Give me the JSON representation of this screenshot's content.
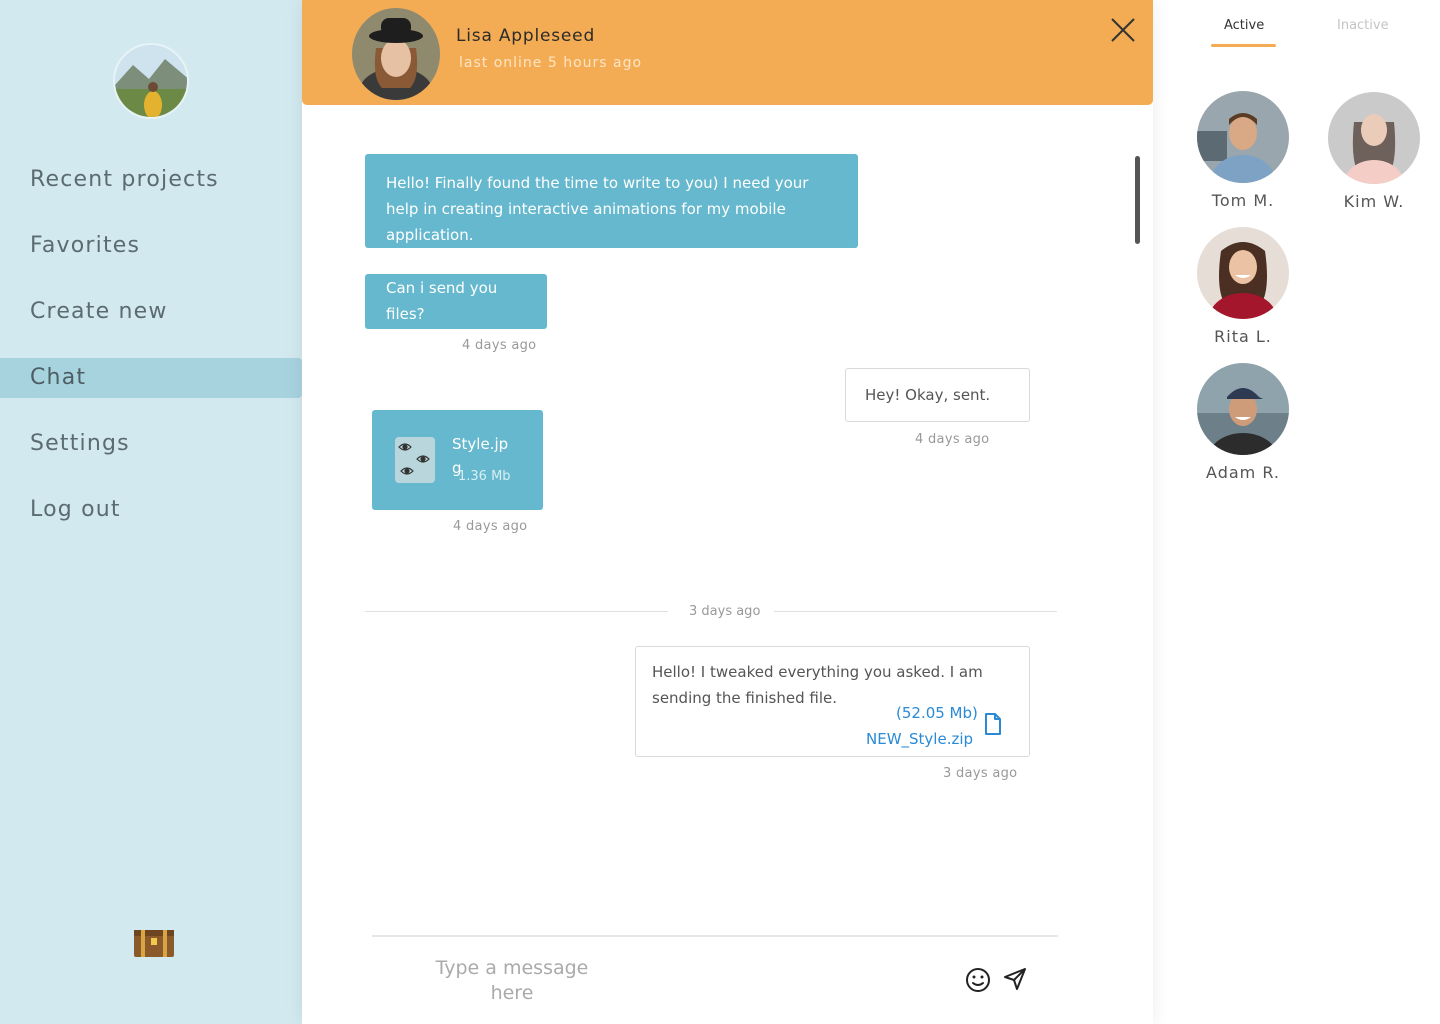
{
  "sidebar": {
    "items": [
      {
        "label": "Recent projects"
      },
      {
        "label": "Favorites"
      },
      {
        "label": "Create new"
      },
      {
        "label": "Chat",
        "active": true
      },
      {
        "label": "Settings"
      },
      {
        "label": "Log out"
      }
    ]
  },
  "header": {
    "name": "Lisa Appleseed",
    "status": "last online 5 hours ago"
  },
  "messages": {
    "m1": "Hello! Finally found the time to write to you) I need your help in creating interactive animations for my mobile application.",
    "m2": "Can i send you files?",
    "m2_time": "4 days ago",
    "m3": "Hey! Okay, sent.",
    "m3_time": "4 days ago",
    "file": {
      "name": "Style.jpg",
      "size": "1.36 Mb"
    },
    "file_time": "4 days ago",
    "divider": "3 days ago",
    "m5": "Hello! I tweaked everything you asked. I am sending the finished file.",
    "m5_attachment_size": "(52.05 Mb)",
    "m5_attachment_name": "NEW_Style.zip",
    "m5_time": "3 days ago"
  },
  "composer": {
    "placeholder": "Type a message here"
  },
  "contacts": {
    "tabs": {
      "active": "Active",
      "inactive": "Inactive"
    },
    "people": [
      {
        "name": "Tom M."
      },
      {
        "name": "Kim W."
      },
      {
        "name": "Rita L."
      },
      {
        "name": "Adam R."
      }
    ]
  },
  "colors": {
    "sidebar_bg": "#d2e9f0",
    "sidebar_active": "#a7d3df",
    "header_bg": "#f4ac54",
    "incoming_bubble": "#65b8cd",
    "link": "#2a8ad6"
  },
  "icons": [
    "close-icon",
    "file-icon",
    "emoji-icon",
    "send-icon",
    "chest-icon"
  ]
}
